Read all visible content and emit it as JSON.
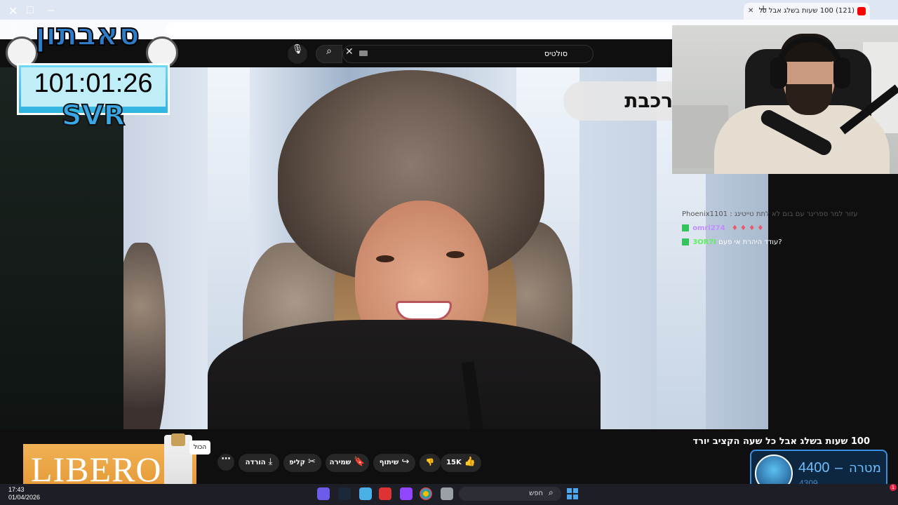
{
  "browser": {
    "tab_title": "(121) 100 שעות בשלג אבל כל",
    "new_tab_icon": "plus-icon"
  },
  "youtube": {
    "search_value": "סולטיס",
    "video_overlay_text": "ר הרכבת",
    "video_title": "100 שעות בשלג אבל כל שעה הקציב יורד",
    "actions": {
      "like_count": "15K",
      "share": "שיתוף",
      "save": "שמירה",
      "clip": "קליפ",
      "download": "הורדה"
    }
  },
  "stream_overlay": {
    "logo_title": "סאבתון",
    "timer": "101:01:26",
    "tag": "SVR"
  },
  "chat": [
    {
      "user": "omri274",
      "message": "",
      "faded": false,
      "user_color": "#c18cff"
    },
    {
      "user": "3OR7I",
      "message": "עודד היהרת אי פעם?",
      "faded": false,
      "user_color": "#5ff05f"
    }
  ],
  "chat_faded_line": "Phoenix1101 : עזור למר ספרינר עם בום לא לתת טייטינג",
  "ad": {
    "brand": "LIBERO",
    "tag": "הכול"
  },
  "goal": {
    "label": "מטרה",
    "target": "4400",
    "current": "4309"
  },
  "taskbar": {
    "time": "17:43",
    "date": "01/04/2026",
    "search_placeholder": "חפש",
    "notification_count": "1"
  },
  "colors": {
    "accent_blue": "#3a8fe0",
    "timer_bg": "#2fb4e0",
    "ad_orange": "#e49632",
    "youtube_red": "#ff0000"
  }
}
